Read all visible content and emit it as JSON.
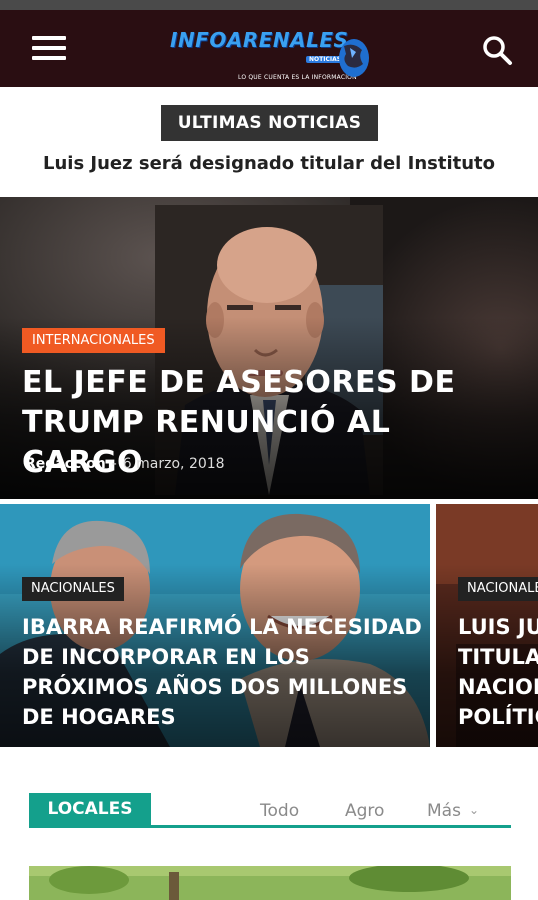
{
  "header": {
    "logo_text": "INFOARENALES",
    "logo_badge": "NOTICIAS",
    "logo_tagline": "LO QUE CUENTA ES LA INFORMACION",
    "menu_icon": "hamburger-menu-icon",
    "search_icon": "search-icon",
    "background_color": "#2a0e12"
  },
  "ticker": {
    "label": "ULTIMAS NOTICIAS",
    "headline": "Luis Juez será designado titular del Instituto"
  },
  "hero": {
    "category": "INTERNACIONALES",
    "category_color": "#f05a23",
    "title": "EL JEFE DE ASESORES DE TRUMP RENUNCIÓ AL CARGO",
    "author": "Redaccion",
    "separator": "-",
    "date": "6 marzo, 2018"
  },
  "carousel": [
    {
      "category": "NACIONALES",
      "title": "IBARRA REAFIRMÓ LA NECESIDAD DE INCORPORAR EN LOS PRÓXIMOS AÑOS DOS MILLONES DE HOGARES"
    },
    {
      "category": "NACIONALES",
      "title_lines": [
        "LUIS JU",
        "TITULA",
        "NACION",
        "POLÍTIC"
      ]
    }
  ],
  "section": {
    "tab_label": "LOCALES",
    "accent_color": "#14a08c",
    "filters": [
      "Todo",
      "Agro",
      "Más"
    ],
    "more_icon": "chevron-down-icon"
  }
}
